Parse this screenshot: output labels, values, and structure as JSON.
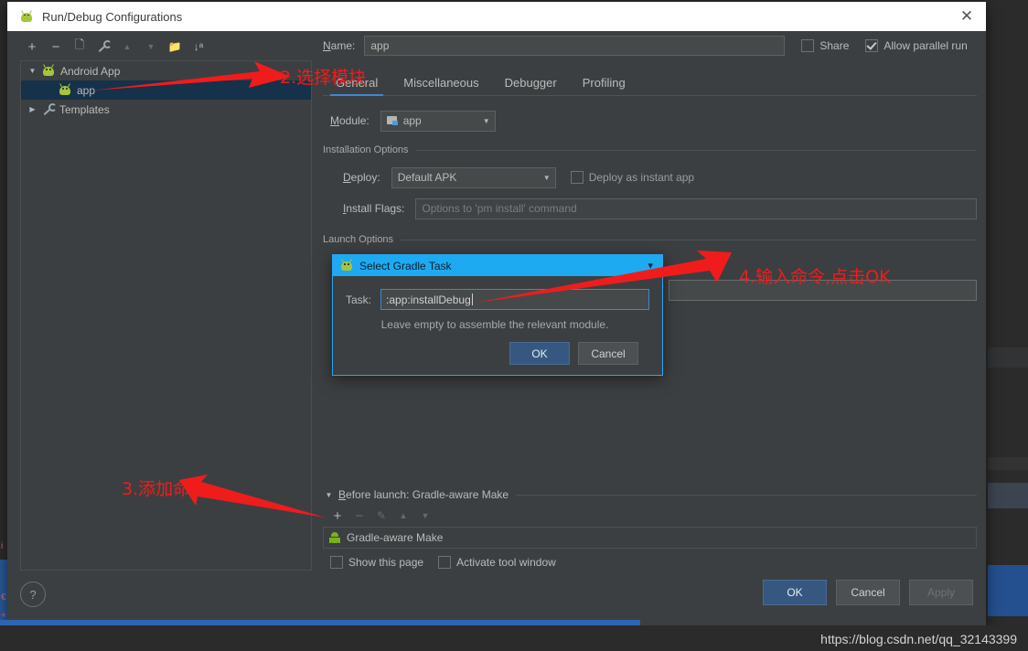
{
  "window": {
    "title": "Run/Debug Configurations",
    "close_icon": "close-icon",
    "app_icon": "android-icon"
  },
  "left_toolbar": [
    {
      "name": "add",
      "glyph": "+",
      "disabled": false
    },
    {
      "name": "remove",
      "glyph": "−",
      "disabled": false
    },
    {
      "name": "copy",
      "glyph": "❐",
      "disabled": false
    },
    {
      "name": "edit-templates",
      "glyph": "ὒ7",
      "disabled": false
    },
    {
      "name": "move-up",
      "glyph": "▲",
      "disabled": true
    },
    {
      "name": "move-down",
      "glyph": "▼",
      "disabled": true
    },
    {
      "name": "new-folder",
      "glyph": "Ὄ1",
      "disabled": false
    },
    {
      "name": "sort-alphabetically",
      "glyph": "↓",
      "disabled": false
    }
  ],
  "tree": [
    {
      "label": "Android App",
      "icon": "android-icon",
      "expanded": true,
      "selected": false,
      "indent": 0
    },
    {
      "label": "app",
      "icon": "android-icon",
      "expanded": null,
      "selected": true,
      "indent": 1
    },
    {
      "label": "Templates",
      "icon": "wrench-icon",
      "expanded": false,
      "selected": false,
      "indent": 0
    }
  ],
  "name_field": {
    "label": "Name:",
    "value": "app"
  },
  "share": {
    "label": "Share",
    "checked": false
  },
  "allow_parallel": {
    "label": "Allow parallel run",
    "checked": true
  },
  "tabs": [
    {
      "label": "General",
      "active": true
    },
    {
      "label": "Miscellaneous",
      "active": false
    },
    {
      "label": "Debugger",
      "active": false
    },
    {
      "label": "Profiling",
      "active": false
    }
  ],
  "module": {
    "label": "Module:",
    "value": "app",
    "icon": "module-icon"
  },
  "installation_options": {
    "section_label": "Installation Options",
    "deploy": {
      "label": "Deploy:",
      "value": "Default APK"
    },
    "instant_app": {
      "label": "Deploy as instant app",
      "checked": false
    },
    "install_flags": {
      "label": "Install Flags:",
      "value": "",
      "placeholder": "Options to 'pm install' command"
    }
  },
  "launch_options": {
    "section_label": "Launch Options"
  },
  "before_launch": {
    "section_label": "Before launch: Gradle-aware Make",
    "toolbar": [
      {
        "name": "add",
        "glyph": "+",
        "disabled": false
      },
      {
        "name": "remove",
        "glyph": "−",
        "disabled": true
      },
      {
        "name": "edit",
        "glyph": "✎",
        "disabled": true
      },
      {
        "name": "move-up",
        "glyph": "▲",
        "disabled": true
      },
      {
        "name": "move-down",
        "glyph": "▼",
        "disabled": true
      }
    ],
    "items": [
      {
        "label": "Gradle-aware Make",
        "icon": "android-robot-icon"
      }
    ],
    "show_this_page": {
      "label": "Show this page",
      "checked": false
    },
    "activate_tool_window": {
      "label": "Activate tool window",
      "checked": false
    }
  },
  "footer": {
    "help_label": "?",
    "ok": "OK",
    "cancel": "Cancel",
    "apply": "Apply"
  },
  "modal": {
    "title": "Select Gradle Task",
    "icon": "android-icon",
    "minimize_icon": "chevron-down-icon",
    "task_label": "Task:",
    "task_value": ":app:installDebug",
    "hint": "Leave empty to assemble the relevant module.",
    "ok": "OK",
    "cancel": "Cancel"
  },
  "annotations": [
    {
      "id": "a2",
      "text": "2.选择模块"
    },
    {
      "id": "a3",
      "text": "3.添加命令"
    },
    {
      "id": "a4",
      "text": "4.输入命令,点击OK"
    }
  ],
  "watermark": "https://blog.csdn.net/qq_32143399",
  "colors": {
    "accent_blue": "#3d87d6",
    "modal_title_blue": "#1eaaf1",
    "annotation_red": "#f01c1c",
    "android_green": "#a4c639",
    "panel_bg": "#3c3f41",
    "selected_row": "#16314a"
  }
}
